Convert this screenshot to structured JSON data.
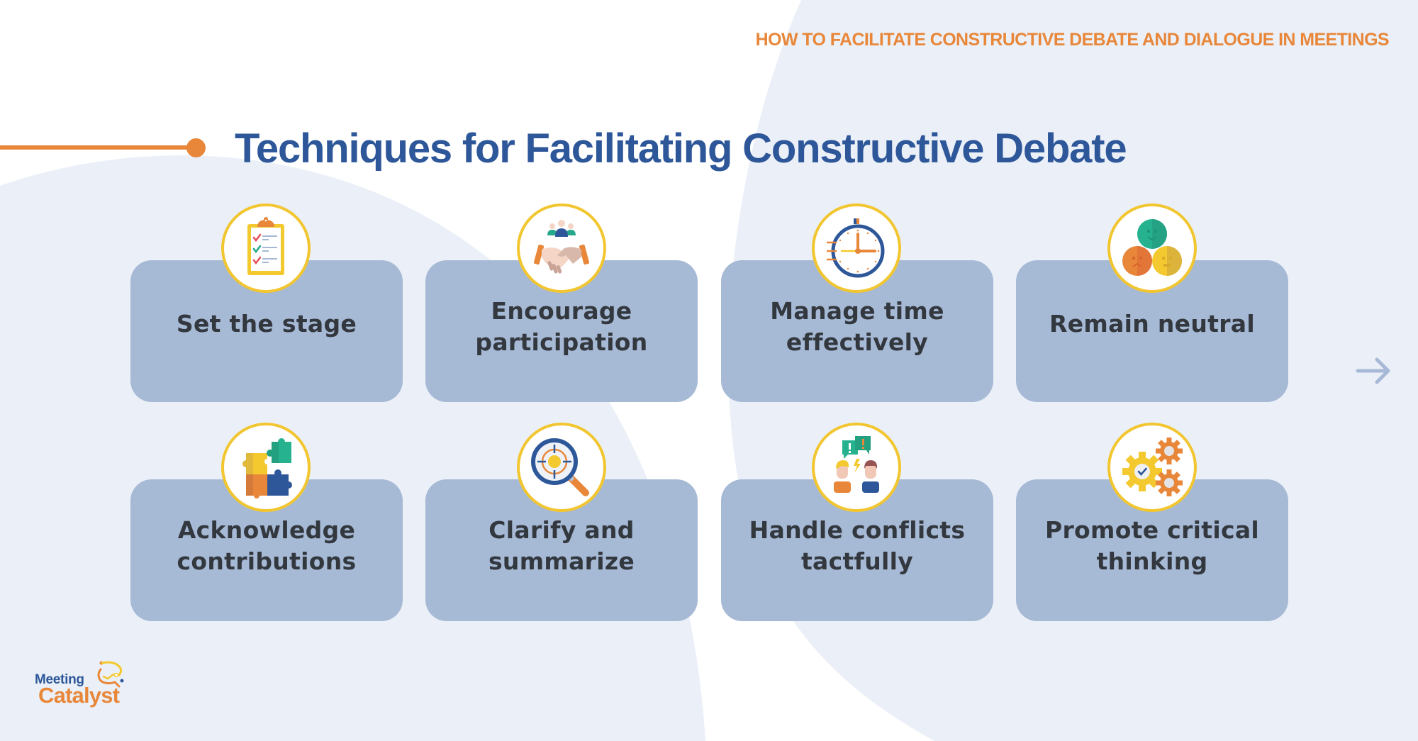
{
  "header": {
    "subtitle": "HOW TO FACILITATE CONSTRUCTIVE DEBATE AND DIALOGUE IN MEETINGS",
    "title": "Techniques for Facilitating Constructive Debate"
  },
  "colors": {
    "accent_orange": "#e8873a",
    "title_blue": "#2e579a",
    "card_bg": "#a6b9d5",
    "badge_ring": "#f2c630",
    "text_dark": "#33383f",
    "bg_light": "#ebf0f8"
  },
  "techniques": [
    {
      "label_line1": "Set the stage",
      "label_line2": "",
      "icon": "clipboard-checklist-icon"
    },
    {
      "label_line1": "Encourage",
      "label_line2": "participation",
      "icon": "handshake-group-icon"
    },
    {
      "label_line1": "Manage time",
      "label_line2": "effectively",
      "icon": "stopwatch-icon"
    },
    {
      "label_line1": "Remain neutral",
      "label_line2": "",
      "icon": "faces-mood-icon"
    },
    {
      "label_line1": "Acknowledge",
      "label_line2": "contributions",
      "icon": "puzzle-pieces-icon"
    },
    {
      "label_line1": "Clarify and",
      "label_line2": "summarize",
      "icon": "magnifier-target-icon"
    },
    {
      "label_line1": "Handle conflicts",
      "label_line2": "tactfully",
      "icon": "people-conflict-icon"
    },
    {
      "label_line1": "Promote critical",
      "label_line2": "thinking",
      "icon": "gears-check-icon"
    }
  ],
  "navigation": {
    "next_icon": "arrow-right-icon"
  },
  "logo": {
    "line1": "Meeting",
    "line2": "Catalyst"
  }
}
